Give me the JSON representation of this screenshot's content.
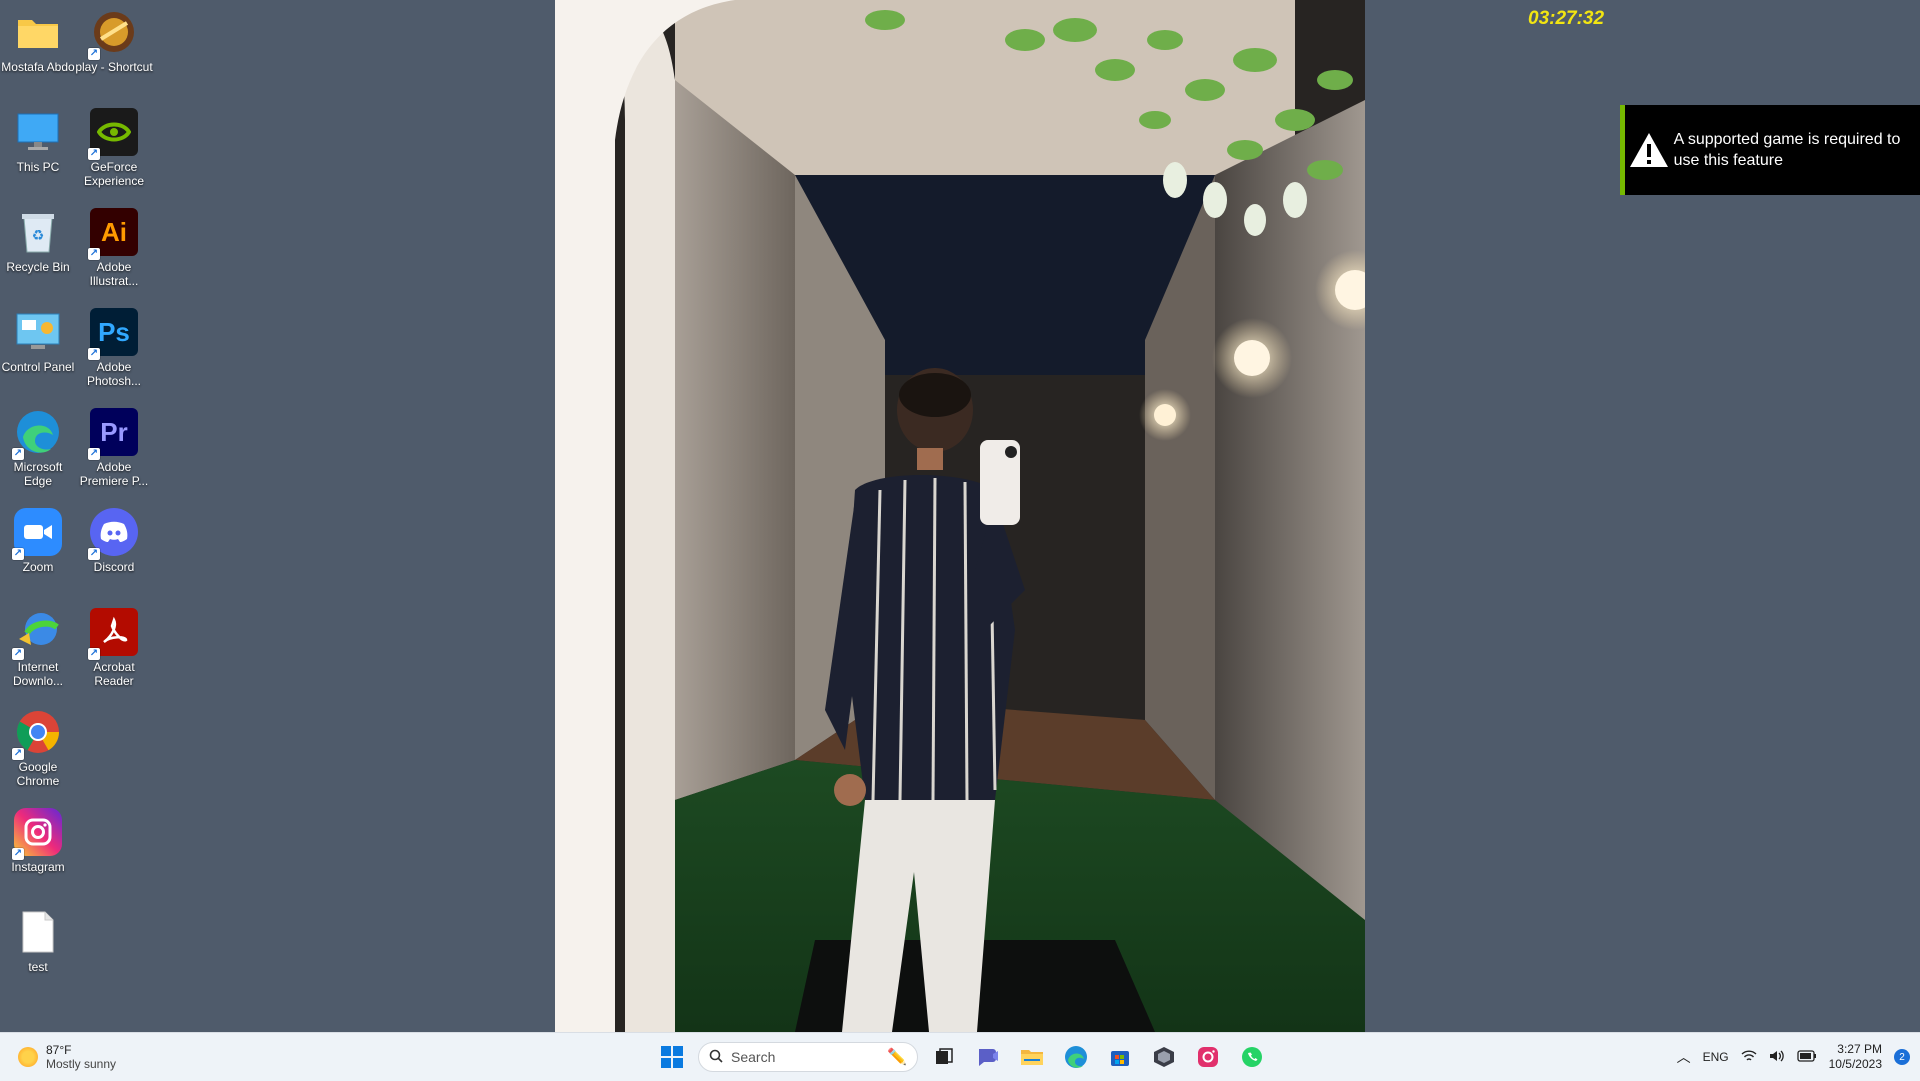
{
  "desktop_icons": [
    {
      "label": "Mostafa Abdo",
      "icon": "folder-icon"
    },
    {
      "label": "play - Shortcut",
      "icon": "game-shortcut-icon"
    },
    {
      "label": "This PC",
      "icon": "monitor-icon"
    },
    {
      "label": "GeForce Experience",
      "icon": "nvidia-icon"
    },
    {
      "label": "Recycle Bin",
      "icon": "recycle-bin-icon"
    },
    {
      "label": "Adobe Illustrat...",
      "icon": "illustrator-icon"
    },
    {
      "label": "Control Panel",
      "icon": "control-panel-icon"
    },
    {
      "label": "Adobe Photosh...",
      "icon": "photoshop-icon"
    },
    {
      "label": "Microsoft Edge",
      "icon": "edge-icon"
    },
    {
      "label": "Adobe Premiere P...",
      "icon": "premiere-icon"
    },
    {
      "label": "Zoom",
      "icon": "zoom-icon"
    },
    {
      "label": "Discord",
      "icon": "discord-icon"
    },
    {
      "label": "Internet Downlo...",
      "icon": "idm-icon"
    },
    {
      "label": "Acrobat Reader",
      "icon": "acrobat-icon"
    },
    {
      "label": "Google Chrome",
      "icon": "chrome-icon"
    },
    {
      "label": "Instagram",
      "icon": "instagram-icon"
    },
    {
      "label": "test",
      "icon": "text-file-icon"
    }
  ],
  "overlay": {
    "timer": "03:27:32"
  },
  "toast": {
    "message": "A supported game is required to use this feature",
    "accent": "#76b900"
  },
  "taskbar": {
    "weather": {
      "temp": "87°F",
      "condition": "Mostly sunny"
    },
    "search_placeholder": "Search",
    "pinned": [
      "start-icon",
      "task-view-icon",
      "chat-icon",
      "file-explorer-icon",
      "edge-icon",
      "store-icon",
      "app-icon",
      "instagram-icon",
      "whatsapp-icon"
    ],
    "tray": {
      "language": "ENG",
      "time": "3:27 PM",
      "date": "10/5/2023",
      "notifications": "2"
    }
  }
}
